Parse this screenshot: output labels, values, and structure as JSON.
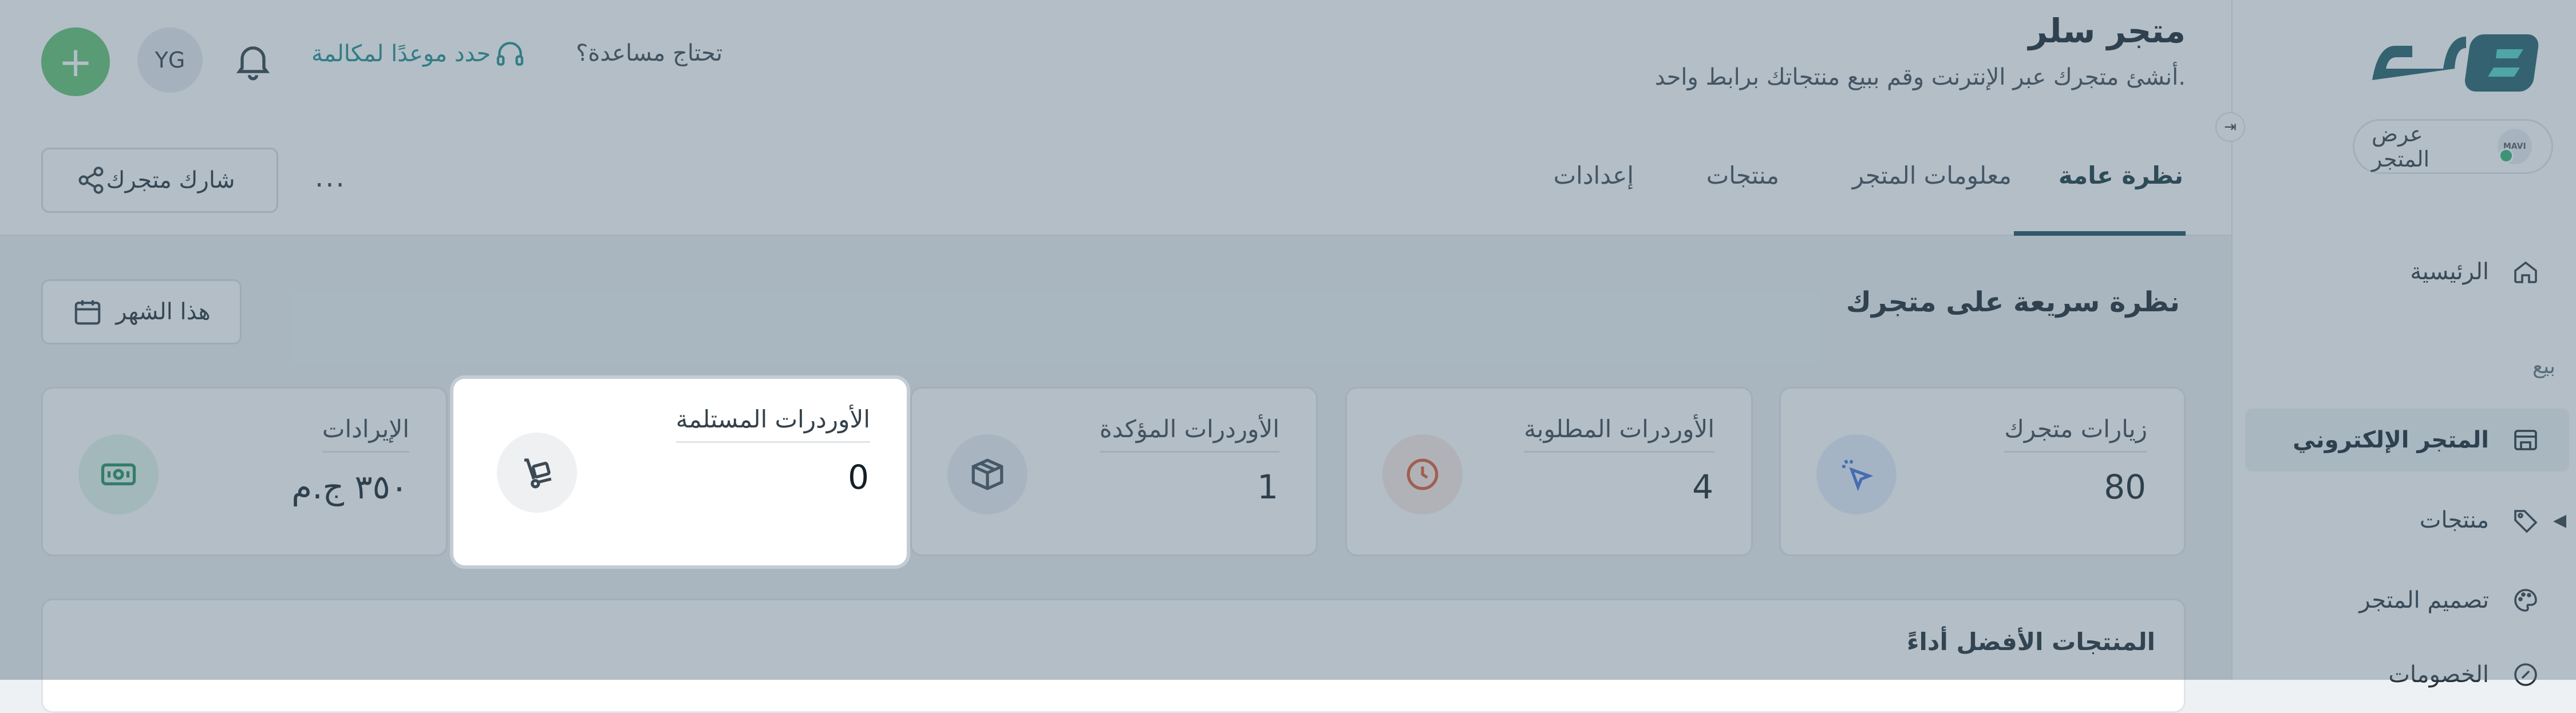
{
  "header": {
    "title": "متجر سلر",
    "subtitle": "أنشئ متجرك عبر الإنترنت وقم ببيع منتجاتك برابط واحد.",
    "help_text": "تحتاج مساعدة؟",
    "book_call": "حدد موعدًا لمكالمة",
    "user_initials": "YG",
    "add_label": "+"
  },
  "sidebar": {
    "logo_text": "سلر",
    "store_pill_label": "عرض المتجر",
    "store_avatar_text": "MAVI",
    "section_sell": "بيع",
    "items": [
      {
        "label": "الرئيسية",
        "icon": "home-icon"
      },
      {
        "label": "المتجر الإلكتروني",
        "icon": "store-icon"
      },
      {
        "label": "منتجات",
        "icon": "tag-icon"
      },
      {
        "label": "تصميم المتجر",
        "icon": "palette-icon"
      },
      {
        "label": "الخصومات",
        "icon": "discount-icon"
      }
    ]
  },
  "tabs": [
    {
      "label": "نظرة عامة",
      "active": true
    },
    {
      "label": "معلومات المتجر",
      "active": false
    },
    {
      "label": "منتجات",
      "active": false
    },
    {
      "label": "إعدادات",
      "active": false
    }
  ],
  "tabs_more": "...",
  "share_button": "شارك متجرك",
  "overview": {
    "title": "نظرة سريعة على متجرك",
    "period": "هذا الشهر"
  },
  "cards": [
    {
      "label": "زيارات متجرك",
      "value": "80",
      "icon": "cursor-click-icon",
      "icon_color": "#3b6fd8",
      "icon_bg": "#e7eefb"
    },
    {
      "label": "الأوردرات المطلوبة",
      "value": "4",
      "icon": "clock-icon",
      "icon_color": "#d9582b",
      "icon_bg": "#fbe9e2"
    },
    {
      "label": "الأوردرات المؤكدة",
      "value": "1",
      "icon": "box-icon",
      "icon_color": "#3d4a55",
      "icon_bg": "#eceff2"
    },
    {
      "label": "الأوردرات المستلمة",
      "value": "0",
      "icon": "hand-truck-icon",
      "icon_color": "#3d4a55",
      "icon_bg": "#eef0f2"
    },
    {
      "label": "الإيرادات",
      "value": "٣٥٠ ج.م",
      "icon": "money-icon",
      "icon_color": "#1f8a5e",
      "icon_bg": "#e1f4ea"
    }
  ],
  "top_products_title": "المنتجات الأفضل أداءً"
}
